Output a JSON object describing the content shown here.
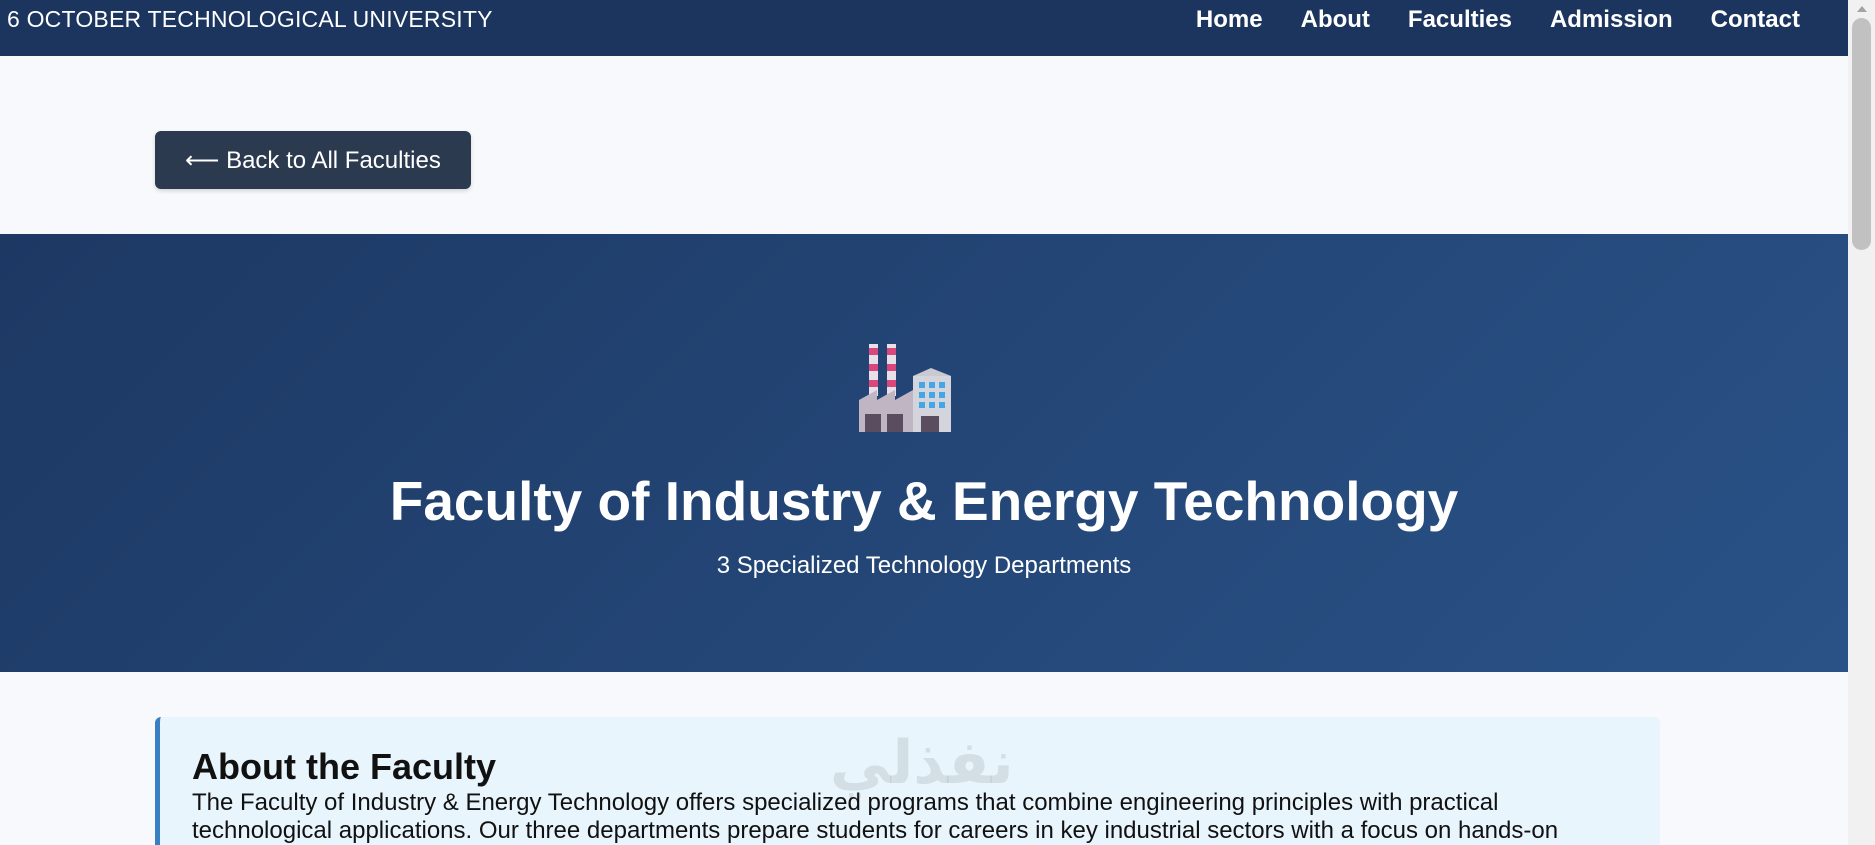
{
  "navbar": {
    "brand": "6 OCTOBER TECHNOLOGICAL UNIVERSITY",
    "links": [
      "Home",
      "About",
      "Faculties",
      "Admission",
      "Contact"
    ],
    "background": "#1c355e"
  },
  "back_button": {
    "label": "⟵ Back to All Faculties"
  },
  "hero": {
    "icon": "factory-icon",
    "title": "Faculty of Industry & Energy Technology",
    "subtitle": "3 Specialized Technology Departments",
    "background": "#244778"
  },
  "about": {
    "heading": "About the Faculty",
    "text": "The Faculty of Industry & Energy Technology offers specialized programs that combine engineering principles with practical technological applications. Our three departments prepare students for careers in key industrial sectors with a focus on hands-on",
    "accent": "#3a7fc1"
  },
  "watermark": "نفذلي"
}
